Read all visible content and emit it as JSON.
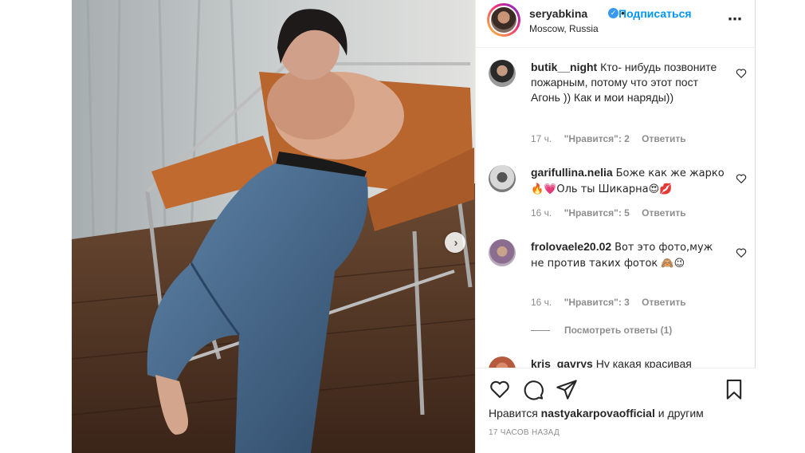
{
  "post": {
    "username": "seryabkina",
    "follow_label": "Подписаться",
    "location": "Moscow, Russia",
    "more_icon": "more-options-icon",
    "verified_icon": "verified-badge-icon"
  },
  "comments": [
    {
      "user": "butik__night",
      "text": "Кто- нибудь позвоните пожарным, потому что этот пост Агонь )) Как и мои наряды))",
      "time": "17 ч.",
      "likes": "\"Нравится\": 2",
      "reply": "Ответить"
    },
    {
      "user": "garifullina.nelia",
      "text": "Боже как же жарко 🔥💗Оль ты Шикарна😍💋",
      "time": "16 ч.",
      "likes": "\"Нравится\": 5",
      "reply": "Ответить"
    },
    {
      "user": "frolovaele20.02",
      "text": "Вот это фото,муж не против таких фоток 🙈😉",
      "time": "16 ч.",
      "likes": "\"Нравится\": 3",
      "reply": "Ответить",
      "view_replies": "Посмотреть ответы (1)"
    },
    {
      "user": "kris_gavrys",
      "text": "Ну какая красивая"
    }
  ],
  "actions": {
    "like_icon": "heart-icon",
    "comment_icon": "comment-icon",
    "share_icon": "share-icon",
    "save_icon": "bookmark-icon",
    "likes_prefix": "Нравится",
    "likes_user": "nastyakarpovaofficial",
    "likes_suffix": "и другим",
    "time_ago": "17 ЧАСОВ НАЗАД"
  },
  "colors": {
    "accent": "#0095f6",
    "text": "#262626",
    "muted": "#8e8e8e",
    "chair_orange": "#b8652e",
    "jeans": "#4a6c90"
  }
}
